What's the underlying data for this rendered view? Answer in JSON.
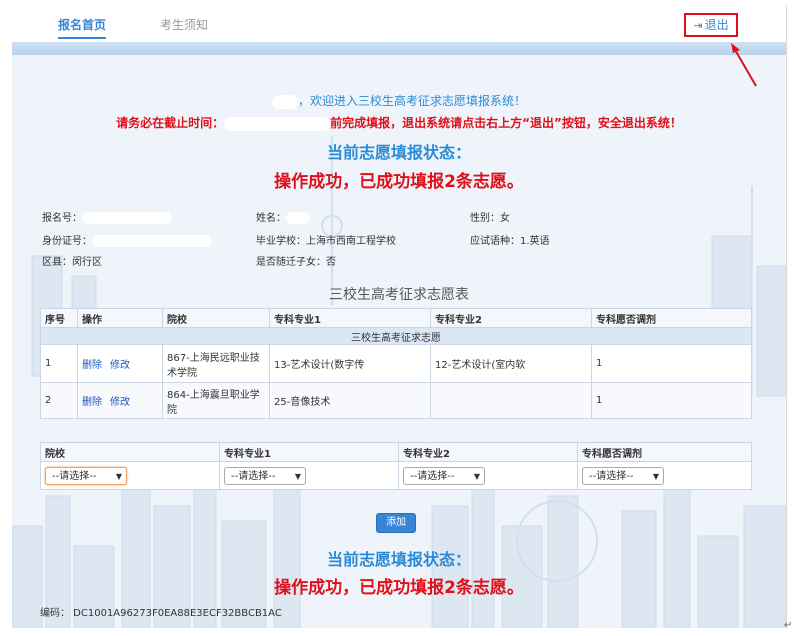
{
  "nav": {
    "home": "报名首页",
    "notice": "考生须知",
    "logout": "退出"
  },
  "welcome": "，欢迎进入三校生高考征求志愿填报系统！",
  "deadline": {
    "prefix": "请务必在截止时间：",
    "suffix": "前完成填报，退出系统请点击右上方“退出”按钮，安全退出系统！"
  },
  "status": {
    "heading": "当前志愿填报状态：",
    "value": "操作成功，已成功填报2条志愿。"
  },
  "info": {
    "reg_no_label": "报名号：",
    "name_label": "姓名：",
    "gender_label": "性别：",
    "gender": "女",
    "id_label": "身份证号：",
    "school_label": "毕业学校：",
    "school": "上海市西南工程学校",
    "lang_label": "应试语种：",
    "lang": "1.英语",
    "district_label": "区县：",
    "district": "闵行区",
    "migrant_label": "是否随迁子女：",
    "migrant": "否"
  },
  "table": {
    "title": "三校生高考征求志愿表",
    "headers": [
      "序号",
      "操作",
      "院校",
      "专科专业1",
      "专科专业2",
      "专科愿否调剂"
    ],
    "group": "三校生高考征求志愿",
    "delete": "删除",
    "edit": "修改",
    "rows": [
      {
        "no": "1",
        "school": "867-上海民远职业技术学院",
        "major1": "13-艺术设计(数字传",
        "major2": "12-艺术设计(室内软",
        "adjust": "1"
      },
      {
        "no": "2",
        "school": "864-上海震旦职业学院",
        "major1": "25-音像技术",
        "major2": "",
        "adjust": "1"
      }
    ]
  },
  "form": {
    "headers": [
      "院校",
      "专科专业1",
      "专科专业2",
      "专科愿否调剂"
    ],
    "placeholder": "--请选择--",
    "add": "添加"
  },
  "code": "编码：  DC1001A96273F0EA88E3ECF32BBCB1AC",
  "colors": {
    "accent": "#3a84d6",
    "alert": "#e0101a"
  }
}
